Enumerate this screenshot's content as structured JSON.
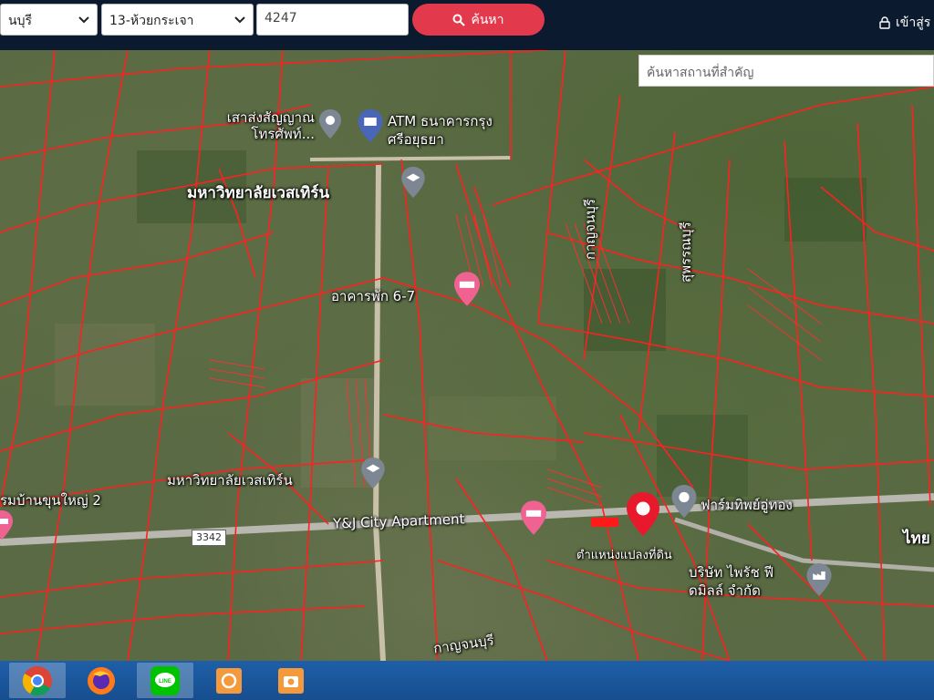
{
  "topbar": {
    "province_select": "นบุรี",
    "district_select": "13-ห้วยกระเจา",
    "parcel_input": "4247",
    "search_button": "ค้นหา",
    "login": "เข้าสู่ร"
  },
  "map": {
    "place_search_placeholder": "ค้นหาสถานที่สำคัญ",
    "road_shield": "3342",
    "labels": {
      "tower": "เสาส่งสัญญาณโทรศัพท์...",
      "atm": "ATM ธนาคารกรุงศรีอยุธยา",
      "western_univ_top": "มหาวิทยาลัยเวสเทิร์น",
      "kanchanaburi": "กาญจนบุรี",
      "suphanburi": "สุพรรณบุรี",
      "dorm": "อาคารพัก 6-7",
      "western_univ_bottom": "มหาวิทยาลัยเวสเทิร์น",
      "village": "รมบ้านขุนใหญ่ 2",
      "apartment": "Y&J City Apartment",
      "pharmacy": "ฟาร์มทิพย์อู่ทอง",
      "parcel_location": "ตำแหน่งแปลงที่ดิน",
      "company": "บริษัท ไพรัช ฟีดมิลล์ จำกัด",
      "thai": "ไทย",
      "bottom_kanchanaburi": "กาญจนบุรี"
    }
  },
  "taskbar": {
    "apps": [
      "chrome-icon",
      "firefox-icon",
      "line-icon",
      "capture-app-icon",
      "camera-app-icon"
    ]
  },
  "colors": {
    "accent": "#e23a4c",
    "topbar": "#0b1a2e",
    "parcel_line": "#ff2020",
    "taskbar": "#1e5fa8"
  }
}
